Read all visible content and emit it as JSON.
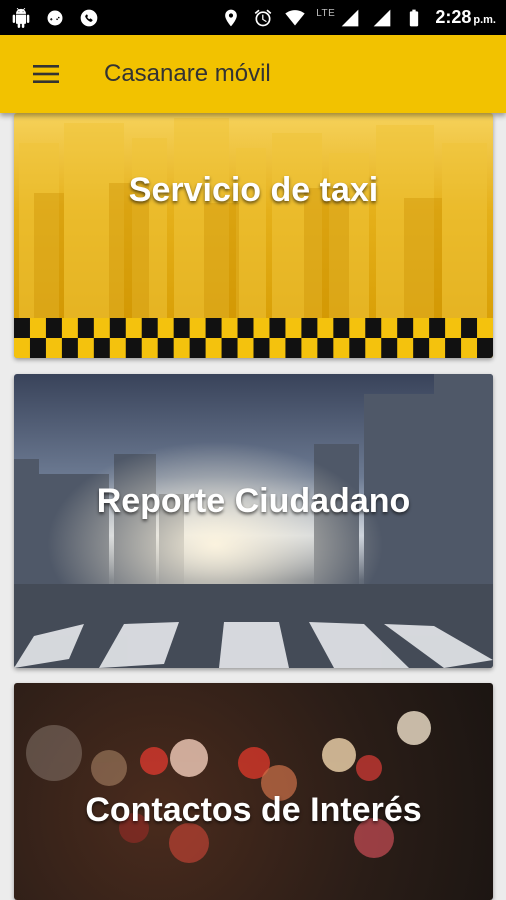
{
  "status_bar": {
    "network_label": "LTE",
    "time": "2:28",
    "ampm": "p.m."
  },
  "app_bar": {
    "title": "Casanare móvil",
    "menu_icon": "hamburger-menu-icon"
  },
  "cards": [
    {
      "label": "Servicio de taxi",
      "theme_color": "#e5b01a"
    },
    {
      "label": "Reporte Ciudadano",
      "theme_color": "#6c7a92"
    },
    {
      "label": "Contactos de Interés",
      "theme_color": "#2a1d17"
    }
  ],
  "colors": {
    "app_bar": "#f2c200",
    "background": "#ececec"
  }
}
